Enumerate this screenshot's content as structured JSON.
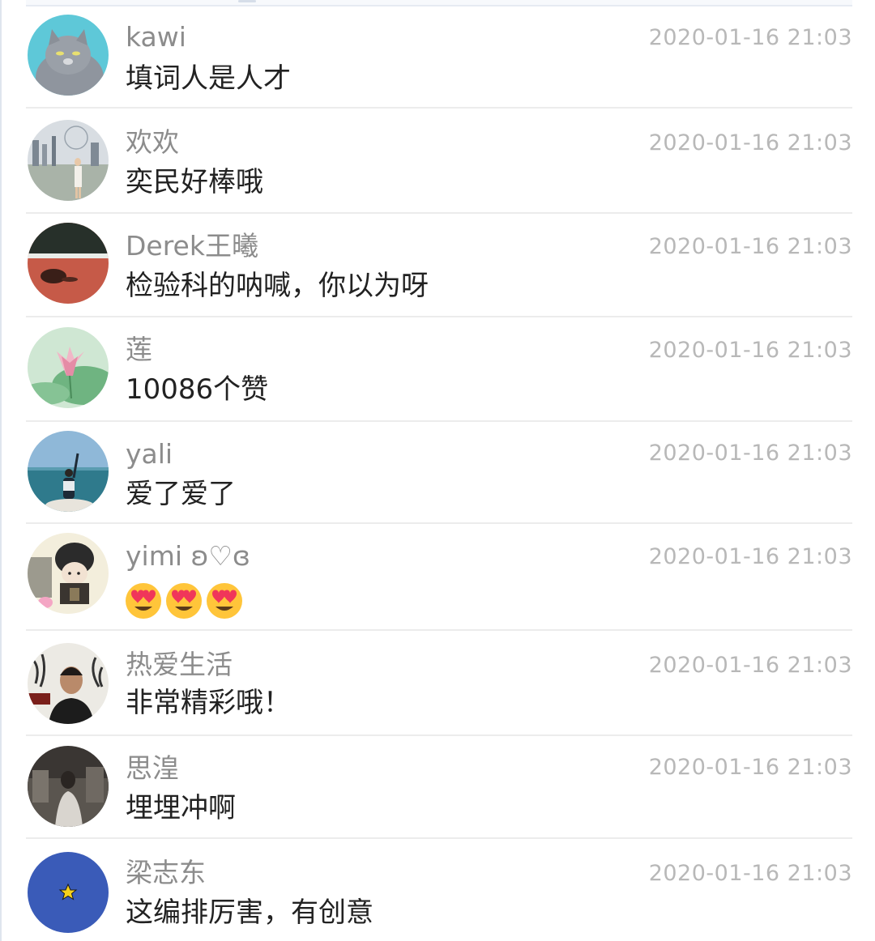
{
  "comments": [
    {
      "name": "kawi",
      "text": "填词人是人才",
      "time": "2020-01-16 21:03",
      "avatar": "cat-avatar"
    },
    {
      "name": "欢欢",
      "text": "奕民好棒哦",
      "time": "2020-01-16 21:03",
      "avatar": "city-photo-avatar"
    },
    {
      "name": "Derek王曦",
      "text": "检验科的呐喊，你以为呀",
      "time": "2020-01-16 21:03",
      "avatar": "track-shadow-avatar"
    },
    {
      "name": "莲",
      "text": "10086个赞",
      "time": "2020-01-16 21:03",
      "avatar": "lotus-avatar"
    },
    {
      "name": "yali",
      "text": "爱了爱了",
      "time": "2020-01-16 21:03",
      "avatar": "sea-photo-avatar"
    },
    {
      "name": "yimi ʚ♡ɞ",
      "text": "",
      "emoji": [
        "heart-eyes",
        "heart-eyes",
        "heart-eyes"
      ],
      "time": "2020-01-16 21:03",
      "avatar": "cartoon-soldier-avatar"
    },
    {
      "name": "热爱生活",
      "text": "非常精彩哦！",
      "time": "2020-01-16 21:03",
      "avatar": "man-calligraphy-avatar"
    },
    {
      "name": "思湟",
      "text": "埋埋冲啊",
      "time": "2020-01-16 21:03",
      "avatar": "dark-photo-avatar"
    },
    {
      "name": "梁志东",
      "text": "这编排厉害，有创意",
      "time": "2020-01-16 21:03",
      "avatar": "blue-star-avatar"
    }
  ],
  "colors": {
    "name": "#8c8c8c",
    "text": "#222222",
    "time": "#b8b8b8",
    "divider": "#ececec",
    "star_avatar_bg": "#3a5bb8",
    "star_color": "#f6d21c"
  }
}
